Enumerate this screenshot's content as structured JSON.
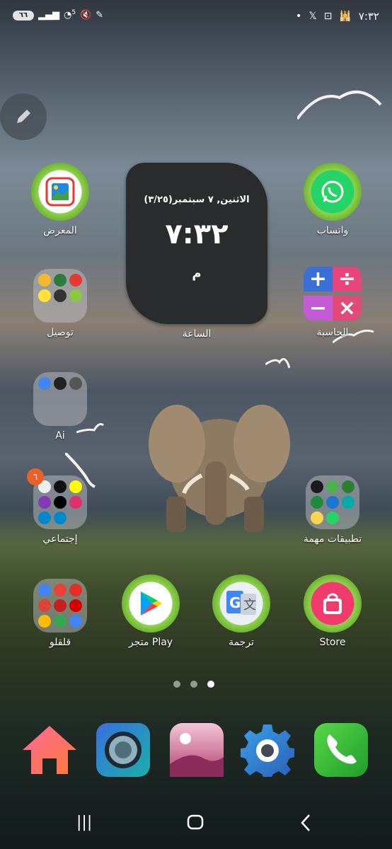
{
  "status_bar": {
    "battery": "٦٦",
    "network": "5",
    "time": "٧:٣٢"
  },
  "clock_widget": {
    "date": "الاثنين, ٧ سبتمبر(٣/٢٥)",
    "time": "٧:٣٢",
    "ampm": "م",
    "label": "الساعة"
  },
  "apps": {
    "gallery": "المعرض",
    "whatsapp": "واتساب",
    "delivery_folder": "توصيل",
    "calculator": "الحاسبة",
    "ai_folder": "Ai",
    "social_folder": "إجتماعي",
    "social_badge": "٦",
    "important_apps_folder": "تطبيقات مهمة",
    "misc_folder": "قلقلو",
    "play_store": "متجر Play",
    "translate": "ترجمة",
    "store": "Store"
  },
  "colors": {
    "accent_green": "#8fd14f",
    "badge_orange": "#e8602a"
  },
  "nav_bar": {
    "recents": "|||",
    "home": "▢",
    "back": "<"
  }
}
